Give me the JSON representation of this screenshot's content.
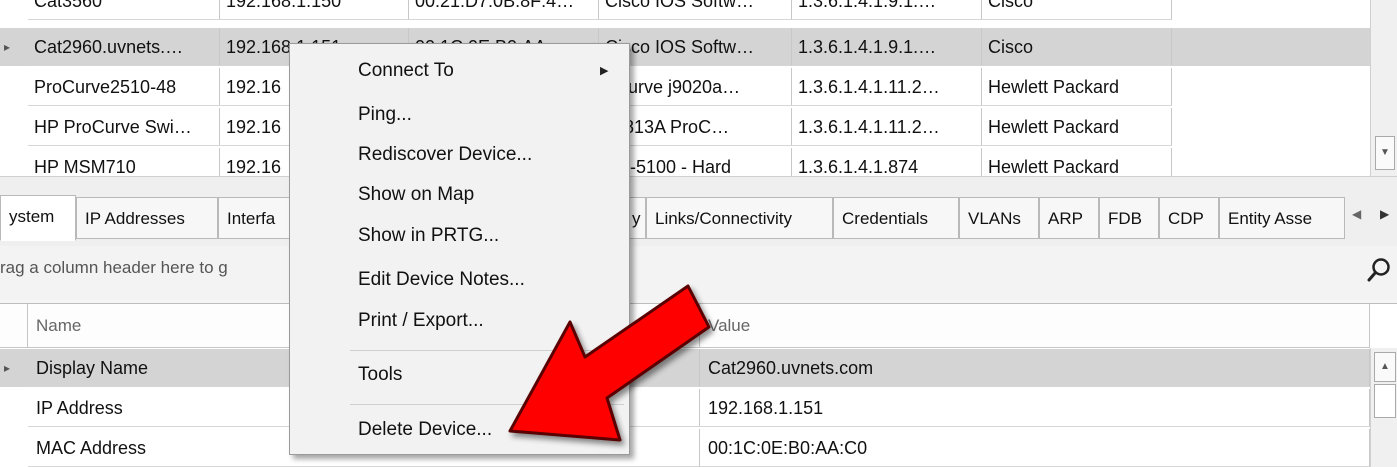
{
  "device_grid": {
    "rows": [
      {
        "cells": [
          "Cat3560",
          "192.168.1.150",
          "00:21:D7:0B:8F:4…",
          "Cisco IOS Softw…",
          "1.3.6.1.4.1.9.1.…",
          "Cisco"
        ],
        "selected": false
      },
      {
        "cells": [
          "Cat2960.uvnets.…",
          "192.168.1.151",
          "00:1C:0E:B0:AA:",
          "Cisco IOS Softw…",
          "1.3.6.1.4.1.9.1.…",
          "Cisco"
        ],
        "selected": true
      },
      {
        "cells": [
          "ProCurve2510-48",
          "192.16",
          "",
          "oCurve j9020a…",
          "1.3.6.1.4.1.11.2…",
          "Hewlett Packard"
        ],
        "selected": false
      },
      {
        "cells": [
          "HP ProCurve Swi…",
          "192.16",
          "",
          "J4813A ProC…",
          "1.3.6.1.4.1.11.2…",
          "Hewlett Packard"
        ],
        "selected": false
      },
      {
        "cells": [
          "HP MSM710",
          "192.16",
          "",
          "SC-5100 - Hard",
          "1.3.6.1.4.1.874",
          "Hewlett Packard"
        ],
        "selected": false
      }
    ]
  },
  "tabs": [
    {
      "label": "ystem",
      "active": true
    },
    {
      "label": "IP Addresses",
      "active": false
    },
    {
      "label": "Interfa",
      "active": false
    },
    {
      "label": "y",
      "active": false
    },
    {
      "label": "Links/Connectivity",
      "active": false
    },
    {
      "label": "Credentials",
      "active": false
    },
    {
      "label": "VLANs",
      "active": false
    },
    {
      "label": "ARP",
      "active": false
    },
    {
      "label": "FDB",
      "active": false
    },
    {
      "label": "CDP",
      "active": false
    },
    {
      "label": "Entity Asse",
      "active": false
    }
  ],
  "group_bar": {
    "hint": "rag a column header here to g"
  },
  "props_grid": {
    "headers": {
      "name": "Name",
      "value": "Value"
    },
    "rows": [
      {
        "name": "Display Name",
        "value": "Cat2960.uvnets.com",
        "selected": true
      },
      {
        "name": "IP Address",
        "value": "192.168.1.151",
        "selected": false
      },
      {
        "name": "MAC Address",
        "value": "00:1C:0E:B0:AA:C0",
        "selected": false
      }
    ]
  },
  "context_menu": {
    "items": [
      {
        "label": "Connect To",
        "submenu": true
      },
      {
        "label": "Ping..."
      },
      {
        "label": "Rediscover Device..."
      },
      {
        "label": "Show on Map"
      },
      {
        "label": "Show in PRTG..."
      },
      {
        "label": "Edit Device Notes..."
      },
      {
        "label": "Print / Export..."
      },
      {
        "label": "Tools"
      },
      {
        "label": "Delete Device..."
      }
    ]
  },
  "colors": {
    "selection": "#d4d4d4",
    "annotation_arrow": "#ff0000"
  }
}
